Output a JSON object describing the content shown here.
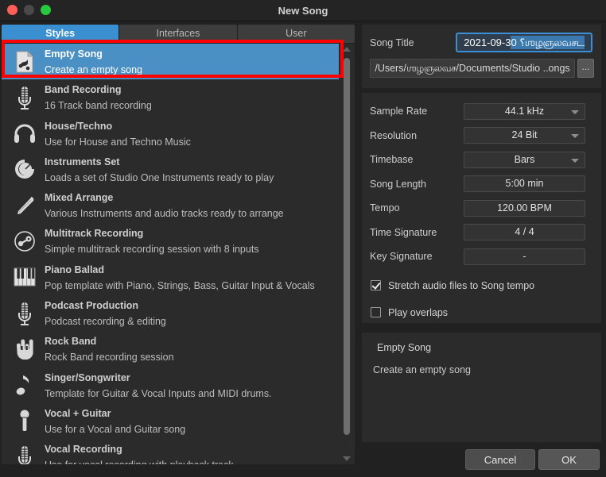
{
  "window": {
    "title": "New Song",
    "traffic_lights": [
      "close-button",
      "minimize-button",
      "maximize-button"
    ]
  },
  "tabs": [
    {
      "label": "Styles",
      "active": true
    },
    {
      "label": "Interfaces",
      "active": false
    },
    {
      "label": "User",
      "active": false
    }
  ],
  "templates": [
    {
      "title": "Empty Song",
      "subtitle": "Create an empty song",
      "icon": "document-song-icon",
      "selected": true
    },
    {
      "title": "Band Recording",
      "subtitle": "16 Track band recording",
      "icon": "microphone-icon",
      "selected": false
    },
    {
      "title": "House/Techno",
      "subtitle": "Use for House and Techno Music",
      "icon": "headphones-icon",
      "selected": false
    },
    {
      "title": "Instruments Set",
      "subtitle": "Loads a set of Studio One Instruments ready to play",
      "icon": "knob-icon",
      "selected": false
    },
    {
      "title": "Mixed Arrange",
      "subtitle": "Various Instruments and audio tracks ready to arrange",
      "icon": "drumstick-icon",
      "selected": false
    },
    {
      "title": "Multitrack Recording",
      "subtitle": "Simple multitrack recording session with 8 inputs",
      "icon": "tape-reel-icon",
      "selected": false
    },
    {
      "title": "Piano Ballad",
      "subtitle": "Pop template with Piano, Strings, Bass, Guitar Input & Vocals",
      "icon": "piano-keys-icon",
      "selected": false
    },
    {
      "title": "Podcast Production",
      "subtitle": "Podcast recording & editing",
      "icon": "microphone-icon",
      "selected": false
    },
    {
      "title": "Rock Band",
      "subtitle": "Rock Band recording session",
      "icon": "rock-hand-icon",
      "selected": false
    },
    {
      "title": "Singer/Songwriter",
      "subtitle": "Template for Guitar & Vocal Inputs and MIDI drums.",
      "icon": "music-note-icon",
      "selected": false
    },
    {
      "title": "Vocal + Guitar",
      "subtitle": "Use for a Vocal and Guitar song",
      "icon": "handheld-mic-icon",
      "selected": false
    },
    {
      "title": "Vocal Recording",
      "subtitle": "Use for vocal recording with playback track",
      "icon": "microphone-icon",
      "selected": false
    }
  ],
  "song_settings": {
    "song_title_label": "Song Title",
    "song_title_prefix": "2021-09-3",
    "song_title_selected": "0 ",
    "song_title_redacted": "⸮ஶழஞலவசட",
    "path_prefix": "/Users/",
    "path_redacted": "ஶழஞலவச",
    "path_suffix": "/Documents/Studio ..ongs",
    "browse_label": "...",
    "rows": [
      {
        "label": "Sample Rate",
        "value": "44.1 kHz",
        "dropdown": true
      },
      {
        "label": "Resolution",
        "value": "24 Bit",
        "dropdown": true
      },
      {
        "label": "Timebase",
        "value": "Bars",
        "dropdown": true
      },
      {
        "label": "Song Length",
        "value": "5:00 min",
        "dropdown": false
      },
      {
        "label": "Tempo",
        "value": "120.00 BPM",
        "dropdown": false
      },
      {
        "label": "Time Signature",
        "value": "4   /   4",
        "dropdown": false
      },
      {
        "label": "Key Signature",
        "value": "-",
        "dropdown": false
      }
    ],
    "checkboxes": [
      {
        "label": "Stretch audio files to Song tempo",
        "checked": true
      },
      {
        "label": "Play overlaps",
        "checked": false
      }
    ]
  },
  "description": {
    "title": "Empty Song",
    "body": "Create an empty song"
  },
  "footer": {
    "cancel_label": "Cancel",
    "ok_label": "OK"
  },
  "colors": {
    "accent": "#3a8fd0",
    "selection": "#4a90c4",
    "annotation": "#fe0000",
    "window_bg": "#212121",
    "panel_bg": "#2b2b2b"
  },
  "annotation": {
    "type": "red-highlight-rectangle",
    "target": "Empty Song"
  }
}
